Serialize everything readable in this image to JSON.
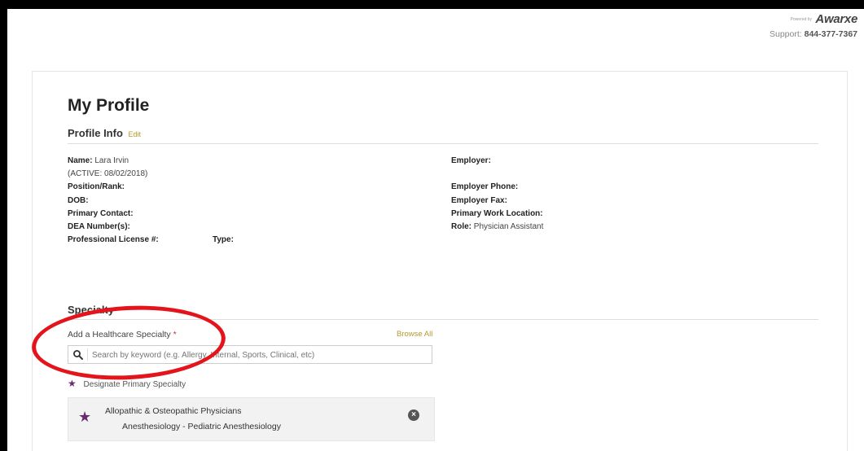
{
  "brand": {
    "powered_by": "Powered by",
    "logo": "Awarxe",
    "support_label": "Support:",
    "support_phone": "844-377-7367"
  },
  "page": {
    "title": "My Profile"
  },
  "profile_info": {
    "heading": "Profile Info",
    "edit_label": "Edit",
    "left": {
      "name_label": "Name:",
      "name_value": "Lara Irvin",
      "status": "(ACTIVE: 08/02/2018)",
      "position_label": "Position/Rank:",
      "dob_label": "DOB:",
      "primary_contact_label": "Primary Contact:",
      "dea_label": "DEA Number(s):",
      "license_label": "Professional License #:",
      "type_label": "Type:"
    },
    "right": {
      "employer_label": "Employer:",
      "employer_phone_label": "Employer Phone:",
      "employer_fax_label": "Employer Fax:",
      "primary_work_location_label": "Primary Work Location:",
      "role_label": "Role:",
      "role_value": "Physician Assistant"
    }
  },
  "specialty": {
    "heading": "Specialty",
    "add_label": "Add a Healthcare Specialty",
    "required_mark": "*",
    "browse_all": "Browse All",
    "search_placeholder": "Search by keyword (e.g. Allergy, Internal, Sports, Clinical, etc)",
    "designate_label": "Designate Primary Specialty",
    "selected": {
      "line1": "Allopathic & Osteopathic Physicians",
      "line2": "Anesthesiology - Pediatric Anesthesiology"
    }
  },
  "colors": {
    "accent_gold": "#b59a2c",
    "star_purple": "#6a2c6f",
    "annotation_red": "#e3141b"
  },
  "icons": [
    "search-icon",
    "star-icon",
    "remove-icon"
  ]
}
